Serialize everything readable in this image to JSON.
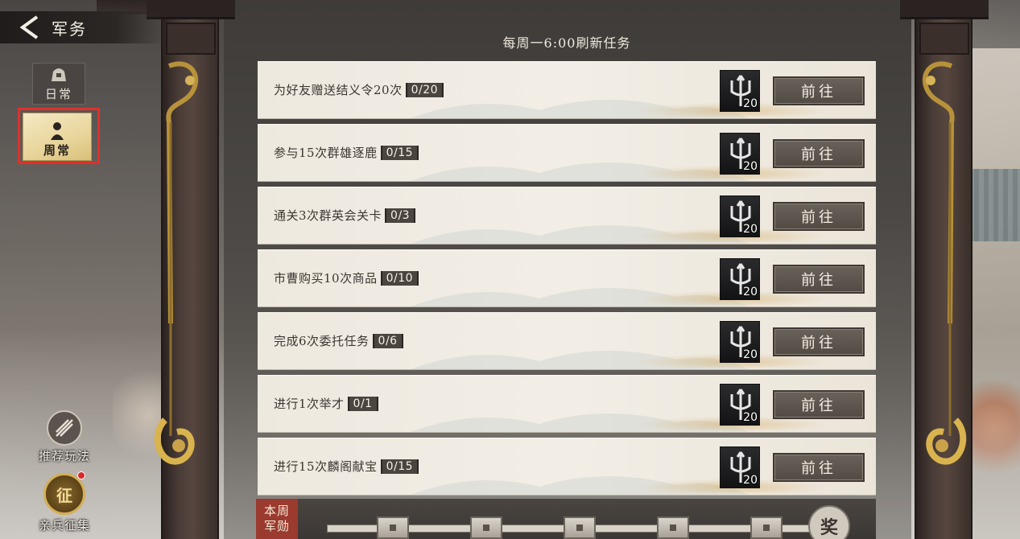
{
  "header": {
    "title": "军务"
  },
  "tabs": [
    {
      "label": "日常",
      "selected": false
    },
    {
      "label": "周常",
      "selected": true
    }
  ],
  "refresh_text": "每周一6:00刷新任务",
  "tasks": [
    {
      "text": "为好友赠送结义令20次",
      "progress": "0/20",
      "reward_count": "20",
      "button": "前往"
    },
    {
      "text": "参与15次群雄逐鹿",
      "progress": "0/15",
      "reward_count": "20",
      "button": "前往"
    },
    {
      "text": "通关3次群英会关卡",
      "progress": "0/3",
      "reward_count": "20",
      "button": "前往"
    },
    {
      "text": "市曹购买10次商品",
      "progress": "0/10",
      "reward_count": "20",
      "button": "前往"
    },
    {
      "text": "完成6次委托任务",
      "progress": "0/6",
      "reward_count": "20",
      "button": "前往"
    },
    {
      "text": "进行1次举才",
      "progress": "0/1",
      "reward_count": "20",
      "button": "前往"
    },
    {
      "text": "进行15次麟阁献宝",
      "progress": "0/15",
      "reward_count": "20",
      "button": "前往"
    }
  ],
  "side_buttons": {
    "recommend": "推荐玩法",
    "recruit": "亲兵征集",
    "recruit_icon_text": "征"
  },
  "bottom": {
    "week_label_line1": "本周",
    "week_label_line2": "军勋",
    "reward_badge": "奖"
  },
  "colors": {
    "highlight": "#e0302a",
    "button": "#5f5850",
    "progress_tag": "#4b4540",
    "week_label": "#9b3a2e"
  }
}
